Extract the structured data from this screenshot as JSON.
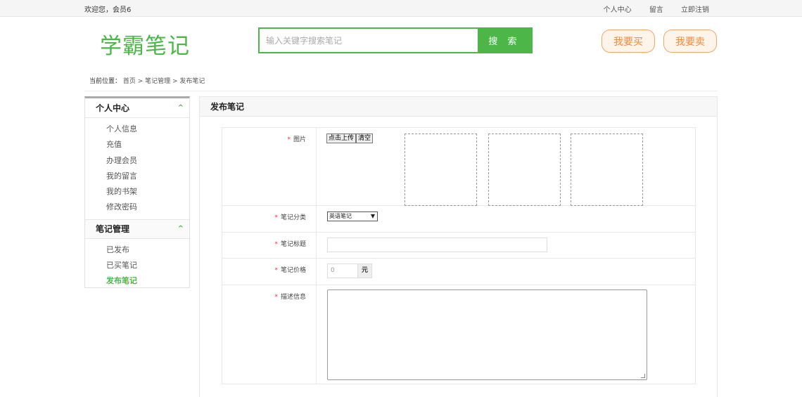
{
  "topbar": {
    "welcome": "欢迎您，会员6",
    "links": [
      "个人中心",
      "留言",
      "立即注销"
    ]
  },
  "header": {
    "logo": "学霸笔记",
    "search_placeholder": "输入关键字搜索笔记",
    "search_button": "搜 索",
    "buy_button": "我要买",
    "sell_button": "我要卖"
  },
  "breadcrumb": {
    "label": "当前位置：",
    "path": "首页 > 笔记管理 > 发布笔记"
  },
  "sidebar": {
    "group1": {
      "title": "个人中心",
      "items": [
        "个人信息",
        "充值",
        "办理会员",
        "我的留言",
        "我的书架",
        "修改密码"
      ]
    },
    "group2": {
      "title": "笔记管理",
      "items": [
        "已发布",
        "已买笔记",
        "发布笔记"
      ]
    }
  },
  "panel": {
    "title": "发布笔记"
  },
  "form": {
    "image_label": "图片",
    "upload_button": "点击上传",
    "clear_button": "清空",
    "category_label": "笔记分类",
    "category_value": "英语笔记",
    "title_label": "笔记标题",
    "price_label": "笔记价格",
    "price_value": "0",
    "price_unit": "元",
    "desc_label": "描述信息",
    "required_mark": "*"
  }
}
